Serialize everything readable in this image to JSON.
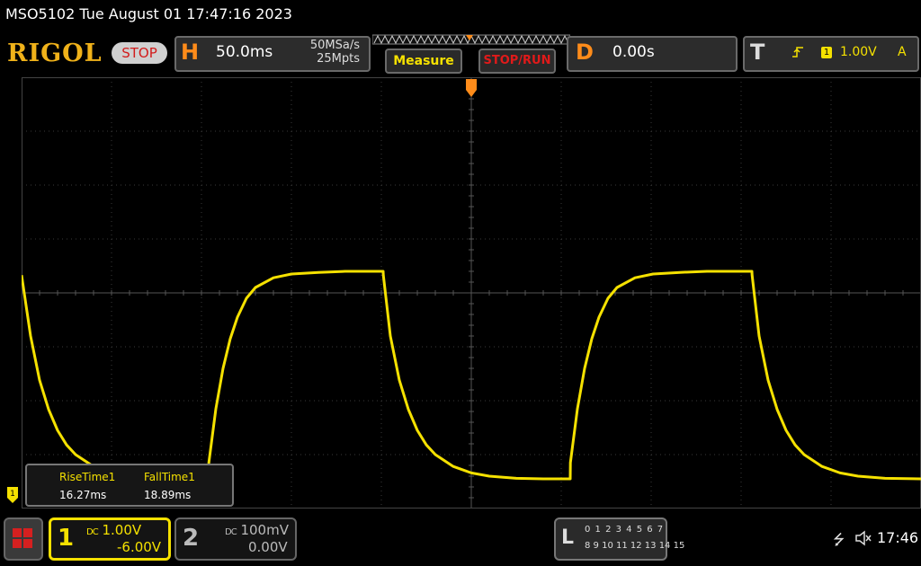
{
  "titlebar": {
    "text": "MSO5102  Tue August 01 17:47:16 2023"
  },
  "toolbar": {
    "logo": "RIGOL",
    "run_state": "STOP",
    "horizontal": {
      "letter": "H",
      "timebase": "50.0ms",
      "sample_rate": "50MSa/s",
      "memory_depth": "25Mpts"
    },
    "measure_label": "Measure",
    "stoprun_label": "STOP/RUN",
    "delay": {
      "letter": "D",
      "value": "0.00s"
    },
    "trigger": {
      "letter": "T",
      "source": "1",
      "level": "1.00V",
      "mode": "A",
      "edge_icon": "rising-edge-icon"
    }
  },
  "measurements": {
    "items": [
      {
        "label": "RiseTime1",
        "value": "16.27ms"
      },
      {
        "label": "FallTime1",
        "value": "18.89ms"
      }
    ]
  },
  "channels": [
    {
      "number": "1",
      "scale": "1.00V",
      "offset": "-6.00V",
      "coupling": "DC",
      "color": "#f5e100",
      "active": true
    },
    {
      "number": "2",
      "scale": "100mV",
      "offset": "0.00V",
      "coupling": "DC",
      "color": "#bbbbbb",
      "active": false
    }
  ],
  "logic_analyzer": {
    "letter": "L",
    "row1": "0 1 2 3  4 5 6 7",
    "row2": "8  9 10 11  12 13 14 15"
  },
  "status": {
    "time": "17:46",
    "usb_icon": "usb-icon",
    "speaker_icon": "speaker-muted-icon"
  },
  "colors": {
    "ch1": "#f5e100",
    "accent": "#ff8c1a",
    "stop": "#d21a1a"
  },
  "chart_data": {
    "type": "line",
    "series": [
      {
        "x": [
          0,
          5,
          10,
          15,
          20,
          25,
          30,
          40,
          50,
          60,
          75,
          90,
          104,
          104.1,
          108,
          112,
          116,
          120,
          125,
          130,
          140,
          150,
          165,
          180,
          200,
          201,
          201.1,
          205,
          210,
          215,
          220,
          225,
          230,
          240,
          250,
          260,
          275,
          290,
          305,
          305.1,
          309,
          313,
          317,
          321,
          326,
          331,
          341,
          351,
          366,
          381,
          405,
          406,
          406.1,
          410,
          415,
          420,
          425,
          430,
          435,
          445,
          455,
          465,
          480,
          500
        ],
        "y": [
          3.93,
          2.8,
          1.98,
          1.44,
          1.05,
          0.78,
          0.6,
          0.38,
          0.26,
          0.2,
          0.16,
          0.15,
          0.15,
          0.45,
          1.45,
          2.2,
          2.75,
          3.15,
          3.5,
          3.7,
          3.88,
          3.95,
          3.98,
          4.0,
          4.0,
          4.0,
          3.93,
          2.8,
          1.98,
          1.44,
          1.05,
          0.78,
          0.6,
          0.38,
          0.26,
          0.2,
          0.16,
          0.15,
          0.15,
          0.45,
          1.45,
          2.2,
          2.75,
          3.15,
          3.5,
          3.7,
          3.88,
          3.95,
          3.98,
          4.0,
          4.0,
          4.0,
          3.93,
          2.8,
          1.98,
          1.44,
          1.05,
          0.78,
          0.6,
          0.38,
          0.26,
          0.2,
          0.16,
          0.15
        ]
      }
    ],
    "xlim": [
      0,
      500
    ],
    "ylim": [
      -0.4,
      7.6
    ],
    "grid": true,
    "grid_divisions": {
      "x": 10,
      "y": 8
    },
    "trigger_time": 250,
    "ch1_ground_level": -0.15
  }
}
